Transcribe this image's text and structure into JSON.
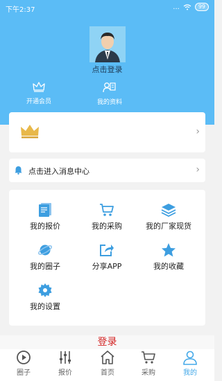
{
  "status_bar": {
    "time": "下午2:37",
    "signal": "...",
    "battery": "99"
  },
  "profile": {
    "login_label": "点击登录"
  },
  "header_actions": [
    {
      "label": "开通会员",
      "icon": "crown-icon"
    },
    {
      "label": "我的资料",
      "icon": "profile-card-icon"
    }
  ],
  "message_center": {
    "label": "点击进入消息中心"
  },
  "grid": [
    {
      "label": "我的报价",
      "icon": "document-icon"
    },
    {
      "label": "我的采购",
      "icon": "cart-icon"
    },
    {
      "label": "我的厂家现货",
      "icon": "layers-icon"
    },
    {
      "label": "我的圈子",
      "icon": "planet-icon"
    },
    {
      "label": "分享APP",
      "icon": "share-icon"
    },
    {
      "label": "我的收藏",
      "icon": "star-icon"
    },
    {
      "label": "我的设置",
      "icon": "settings-icon"
    }
  ],
  "bottom_login": "登录",
  "tabs": [
    {
      "label": "圈子",
      "icon": "circle-play-icon"
    },
    {
      "label": "报价",
      "icon": "sliders-icon"
    },
    {
      "label": "首页",
      "icon": "home-icon"
    },
    {
      "label": "采购",
      "icon": "cart-icon"
    },
    {
      "label": "我的",
      "icon": "person-icon",
      "active": true
    }
  ],
  "colors": {
    "header": "#5bbcf6",
    "accent": "#43a8e8",
    "login_red": "#d32424",
    "crown_gold": "#e8b84a"
  }
}
